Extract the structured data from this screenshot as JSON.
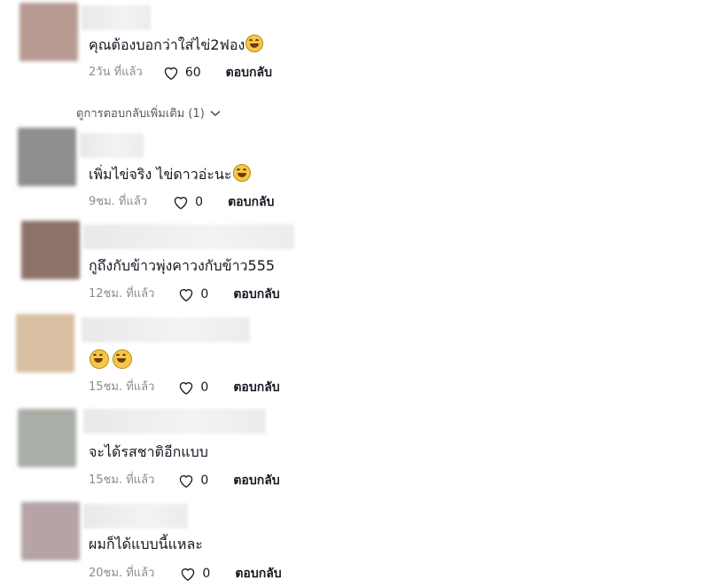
{
  "reply_label": "ตอบกลับ",
  "comments": [
    {
      "text": "คุณต้องบอกว่าใส่ไข่2ฟอง",
      "emojis": 1,
      "time": "2วัน ที่แล้ว",
      "likes": "60"
    },
    {
      "text": "เพิ่มไข่จริง ไข่ดาวอ่ะนะ",
      "emojis": 1,
      "time": "9ชม. ที่แล้ว",
      "likes": "0"
    },
    {
      "text": "กูถึงกับข้าวพุ่งคาวงกับข้าว555",
      "emojis": 0,
      "time": "12ชม. ที่แล้ว",
      "likes": "0"
    },
    {
      "text": "",
      "emojis": 2,
      "time": "15ชม. ที่แล้ว",
      "likes": "0"
    },
    {
      "text": "จะได้รสชาติอีกแบบ",
      "emojis": 0,
      "time": "15ชม. ที่แล้ว",
      "likes": "0"
    },
    {
      "text": "ผมก็ได้แบบนี้แหละ",
      "emojis": 0,
      "time": "20ชม. ที่แล้ว",
      "likes": "0"
    }
  ],
  "view_more": "ดูการตอบกลับเพิ่มเติม (1)",
  "colors": {
    "avatars": [
      "#b79a92",
      "#8e8e90",
      "#8d726a",
      "#d9bfa2",
      "#a9aea6",
      "#b5a3a6"
    ]
  }
}
